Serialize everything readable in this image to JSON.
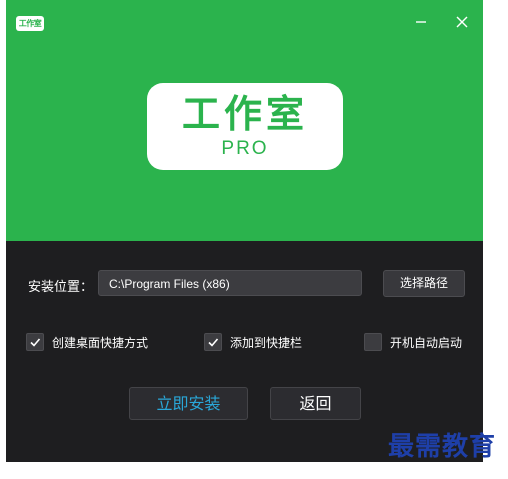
{
  "header": {
    "small_logo_text": "工作室",
    "logo_title": "工作室",
    "logo_subtitle": "PRO",
    "accent_color": "#2bb34d"
  },
  "window_controls": {
    "minimize_icon": "minimize-icon",
    "close_icon": "close-icon"
  },
  "install": {
    "label": "安装位置：",
    "path": "C:\\Program Files (x86)",
    "browse_label": "选择路径"
  },
  "options": [
    {
      "label": "创建桌面快捷方式",
      "checked": true
    },
    {
      "label": "添加到快捷栏",
      "checked": true
    },
    {
      "label": "开机自动启动",
      "checked": false
    }
  ],
  "actions": {
    "install_now": "立即安装",
    "back": "返回"
  },
  "brand": "最需教育"
}
